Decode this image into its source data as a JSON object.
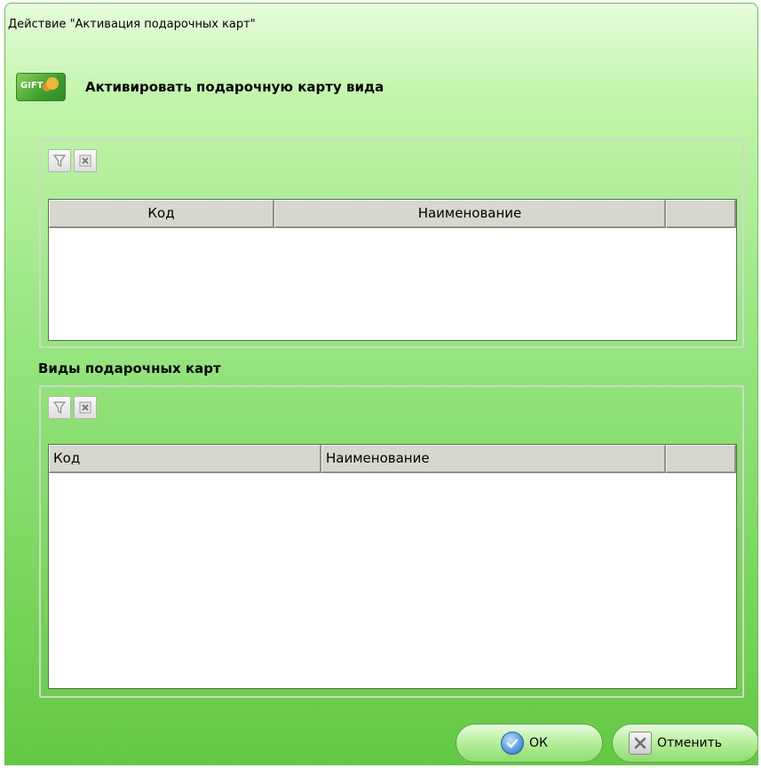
{
  "window": {
    "title": "Действие \"Активация подарочных карт\""
  },
  "header": {
    "icon": "gift-card-icon",
    "text": "Активировать подарочную карту вида"
  },
  "grid1": {
    "toolbar": {
      "filter_icon": "filter-icon",
      "clear_icon": "clear-filter-icon"
    },
    "columns": [
      "Код",
      "Наименование",
      ""
    ]
  },
  "section2": {
    "label": "Виды подарочных карт"
  },
  "grid2": {
    "toolbar": {
      "filter_icon": "filter-icon",
      "clear_icon": "clear-filter-icon"
    },
    "columns": [
      "Код",
      "Наименование",
      ""
    ]
  },
  "buttons": {
    "ok_label": "ОК",
    "cancel_label": "Отменить"
  },
  "colors": {
    "window_green": "#7ad75e",
    "header_gray": "#d7d6cf",
    "ok_blue": "#3f7fd0"
  }
}
